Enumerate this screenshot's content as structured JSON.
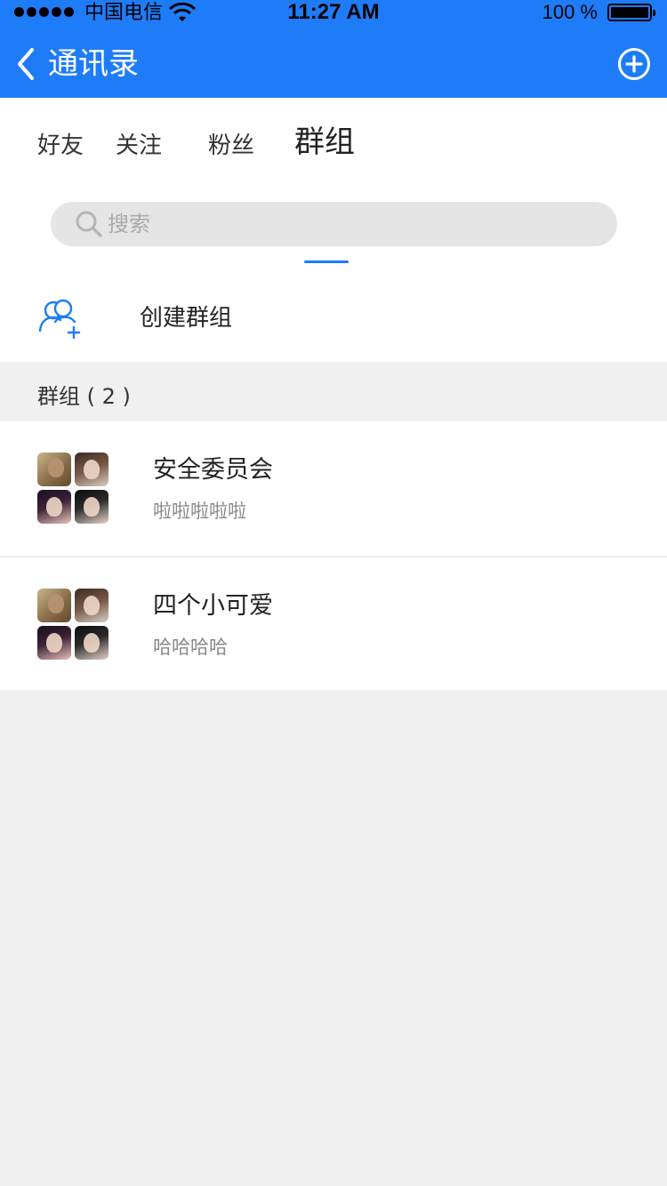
{
  "status_bar": {
    "carrier": "中国电信",
    "time": "11:27 AM",
    "battery": "100 %"
  },
  "nav": {
    "title": "通讯录",
    "back_icon": "chevron-left-icon",
    "add_icon": "plus-circle-icon"
  },
  "tabs": [
    {
      "label": "好友",
      "active": false
    },
    {
      "label": "关注",
      "active": false
    },
    {
      "label": "粉丝",
      "active": false
    },
    {
      "label": "群组",
      "active": true
    }
  ],
  "search": {
    "placeholder": "搜索"
  },
  "create_group": {
    "label": "创建群组",
    "icon": "add-user-group-icon"
  },
  "section": {
    "title": "群组 ( 2 )"
  },
  "groups": [
    {
      "name": "安全委员会",
      "desc": "啦啦啦啦啦"
    },
    {
      "name": "四个小可爱",
      "desc": "哈哈哈哈"
    }
  ],
  "colors": {
    "accent": "#1f7cf9",
    "background": "#f0f0f0"
  }
}
